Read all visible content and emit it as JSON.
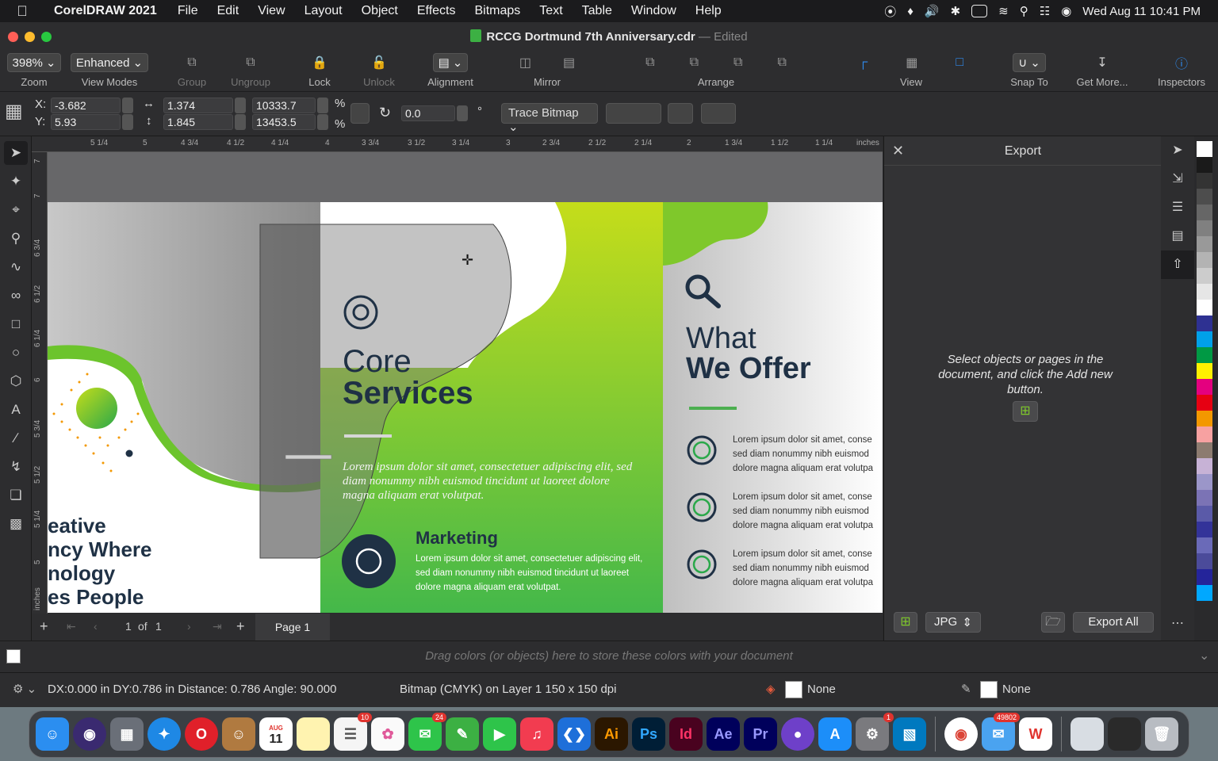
{
  "menubar": {
    "app_name": "CorelDRAW 2021",
    "items": [
      "File",
      "Edit",
      "View",
      "Layout",
      "Object",
      "Effects",
      "Bitmaps",
      "Text",
      "Table",
      "Window",
      "Help"
    ],
    "clock": "Wed Aug 11  10:41 PM"
  },
  "window": {
    "file_name": "RCCG Dortmund 7th Anniversary.cdr",
    "separator": "—",
    "state": "Edited"
  },
  "toolbar": {
    "zoom_value": "398%",
    "view_mode_value": "Enhanced",
    "labels": {
      "zoom": "Zoom",
      "view_modes": "View Modes",
      "group": "Group",
      "ungroup": "Ungroup",
      "lock": "Lock",
      "unlock": "Unlock",
      "alignment": "Alignment",
      "mirror": "Mirror",
      "arrange": "Arrange",
      "view": "View",
      "snap_to": "Snap To",
      "get_more": "Get More...",
      "inspectors": "Inspectors"
    }
  },
  "properties": {
    "x_label": "X:",
    "y_label": "Y:",
    "x": "-3.682",
    "y": "5.93",
    "width": "1.374",
    "height": "1.845",
    "scale_w": "10333.7",
    "scale_h": "13453.5",
    "percent": "%",
    "rotation": "0.0",
    "degree": "°",
    "trace_bitmap": "Trace Bitmap"
  },
  "ruler": {
    "top_ticks": [
      "5 1/4",
      "5",
      "4 3/4",
      "4 1/2",
      "4 1/4",
      "4",
      "3 3/4",
      "3 1/2",
      "3 1/4",
      "3",
      "2 3/4",
      "2 1/2",
      "2 1/4",
      "2",
      "1 3/4",
      "1 1/2",
      "1 1/4"
    ],
    "unit": "inches",
    "left_ticks": [
      "7",
      "7",
      "6 3/4",
      "6 1/2",
      "6 1/4",
      "6",
      "5 3/4",
      "5 1/2",
      "5 1/4",
      "5"
    ],
    "left_unit": "inches"
  },
  "design": {
    "core_services_line1": "Core",
    "core_services_line2": "Services",
    "core_body": "Lorem ipsum dolor sit amet, consectetuer adipiscing elit, sed diam nonummy nibh euismod tincidunt ut laoreet dolore magna aliquam erat volutpat.",
    "marketing_title": "Marketing",
    "marketing_body": "Lorem ipsum dolor sit amet, consectetuer adipiscing elit, sed diam nonummy nibh euismod tincidunt ut laoreet dolore magna aliquam erat volutpat.",
    "what_line1": "What",
    "what_line2": "We Offer",
    "offer_items": [
      "Lorem ipsum dolor sit amet, conse sed diam nonummy nibh euismod dolore magna aliquam erat volutpa",
      "Lorem ipsum dolor sit amet, conse sed diam nonummy nibh euismod dolore magna aliquam erat volutpa",
      "Lorem ipsum dolor sit amet, conse sed diam nonummy nibh euismod dolore magna aliquam erat volutpa"
    ],
    "left_lines": [
      "eative",
      "ncy Where",
      "nology",
      "es People"
    ],
    "accent_green": "#7fc82b",
    "navy": "#1f3145"
  },
  "pagebar": {
    "page_current": "1",
    "of": "of",
    "page_total": "1",
    "tab": "Page 1"
  },
  "export_panel": {
    "title": "Export",
    "hint": "Select objects or pages in the document, and click the Add new button.",
    "format": "JPG",
    "export_all": "Export All"
  },
  "palette": [
    "#ffffff",
    "#1a1a1a",
    "#333333",
    "#4d4d4d",
    "#666666",
    "#808080",
    "#999999",
    "#b3b3b3",
    "#cccccc",
    "#e6e6e6",
    "#ffffff",
    "#2e3192",
    "#00a0e9",
    "#009944",
    "#fff100",
    "#e4007f",
    "#e60012",
    "#f39800",
    "#f7a1a1",
    "#8c7b70",
    "#c7b2d6",
    "#9b96c9",
    "#7b73b5",
    "#5a5aa8",
    "#333399",
    "#6a6ab8",
    "#4b4b9a",
    "#24249a",
    "#00a8ff"
  ],
  "color_tray": {
    "hint": "Drag colors (or objects) here to store these colors with your document"
  },
  "status": {
    "measure": "DX:0.000 in DY:0.786 in Distance: 0.786 Angle: 90.000",
    "object_info": "Bitmap (CMYK) on Layer 1 150 x 150 dpi",
    "fill": "None",
    "outline": "None"
  },
  "dock": {
    "apps": [
      "Finder",
      "Siri",
      "Launchpad",
      "Safari",
      "Opera",
      "Contacts",
      "Calendar",
      "Notes",
      "Reminders",
      "Photos",
      "Messages",
      "CorelDRAW",
      "FaceTime",
      "Music",
      "VS Code",
      "Illustrator",
      "Photoshop",
      "InDesign",
      "After Effects",
      "Premiere Pro",
      "GitHub Desktop",
      "App Store",
      "System Preferences",
      "Trello",
      "Chrome",
      "Mail",
      "WPS",
      "Archive",
      "Terminal",
      "Trash"
    ],
    "calendar_month": "AUG",
    "calendar_day": "11",
    "badges": {
      "reminders": "10",
      "messages": "24",
      "system": "1",
      "mail": "49802"
    },
    "letters": {
      "illustrator": "Ai",
      "photoshop": "Ps",
      "indesign": "Id",
      "after_effects": "Ae",
      "premiere": "Pr"
    }
  }
}
